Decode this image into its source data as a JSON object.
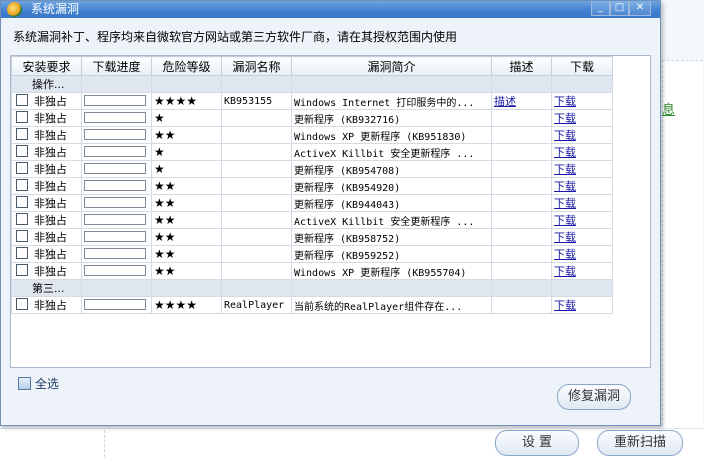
{
  "dialog": {
    "title": "系统漏洞",
    "description": "系统漏洞补丁、程序均来自微软官方网站或第三方软件厂商，请在其授权范围内使用",
    "select_all": "全选",
    "repair_button": "修复漏洞"
  },
  "table": {
    "columns": [
      "安装要求",
      "下载进度",
      "危险等级",
      "漏洞名称",
      "漏洞简介",
      "描述",
      "下载"
    ],
    "groups": [
      {
        "label": "操作...",
        "rows": [
          {
            "requirement": "非独占",
            "risk": "★★★★",
            "name": "KB953155",
            "summary": "Windows Internet 打印服务中的...",
            "desc": "描述",
            "download": "下载"
          },
          {
            "requirement": "非独占",
            "risk": "★",
            "name": "",
            "summary": "更新程序 (KB932716)",
            "desc": "",
            "download": "下载"
          },
          {
            "requirement": "非独占",
            "risk": "★★",
            "name": "",
            "summary": "Windows XP 更新程序 (KB951830)",
            "desc": "",
            "download": "下载"
          },
          {
            "requirement": "非独占",
            "risk": "★",
            "name": "",
            "summary": "ActiveX Killbit 安全更新程序 ...",
            "desc": "",
            "download": "下载"
          },
          {
            "requirement": "非独占",
            "risk": "★",
            "name": "",
            "summary": "更新程序 (KB954708)",
            "desc": "",
            "download": "下载"
          },
          {
            "requirement": "非独占",
            "risk": "★★",
            "name": "",
            "summary": "更新程序 (KB954920)",
            "desc": "",
            "download": "下载"
          },
          {
            "requirement": "非独占",
            "risk": "★★",
            "name": "",
            "summary": "更新程序 (KB944043)",
            "desc": "",
            "download": "下载"
          },
          {
            "requirement": "非独占",
            "risk": "★★",
            "name": "",
            "summary": "ActiveX Killbit 安全更新程序 ...",
            "desc": "",
            "download": "下载"
          },
          {
            "requirement": "非独占",
            "risk": "★★",
            "name": "",
            "summary": "更新程序 (KB958752)",
            "desc": "",
            "download": "下载"
          },
          {
            "requirement": "非独占",
            "risk": "★★",
            "name": "",
            "summary": "更新程序 (KB959252)",
            "desc": "",
            "download": "下载"
          },
          {
            "requirement": "非独占",
            "risk": "★★",
            "name": "",
            "summary": "Windows XP 更新程序 (KB955704)",
            "desc": "",
            "download": "下载"
          }
        ]
      },
      {
        "label": "第三...",
        "rows": [
          {
            "requirement": "非独占",
            "risk": "★★★★",
            "name": "RealPlayer",
            "summary": "当前系统的RealPlayer组件存在...",
            "desc": "",
            "download": "下载"
          }
        ]
      }
    ]
  },
  "background": {
    "link_fragment": "息",
    "settings_button": "设 置",
    "rescan_button": "重新扫描"
  }
}
